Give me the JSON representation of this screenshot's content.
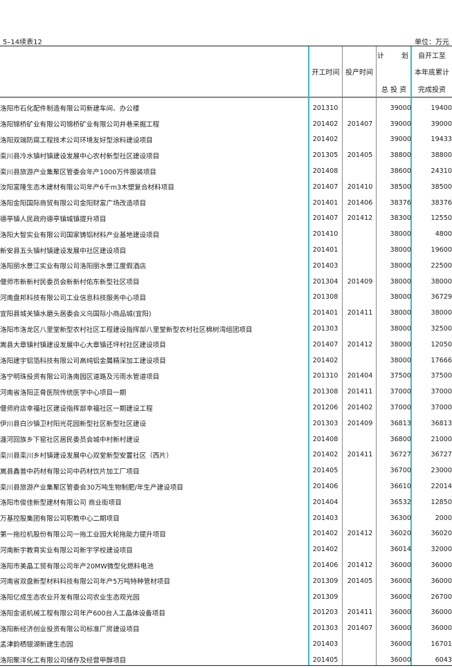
{
  "header": {
    "table_id": "5–14续表12",
    "unit": "单位：万元"
  },
  "columns": {
    "start_time": "开工时间",
    "operation_time": "投产时间",
    "plan_top": [
      "计",
      "划"
    ],
    "plan_bottom": "总 投 资",
    "cumulative": [
      "自开工至",
      "本年底累计",
      "完成投资"
    ]
  },
  "rows": [
    {
      "name": "洛阳市石化配件制造有限公司新建车间、办公楼",
      "start": "201310",
      "op": "",
      "total": "39000",
      "cum": "19400"
    },
    {
      "name": "洛阳锦桥矿业有限公司锦桥矿业有限公司井巷采掘工程",
      "start": "201402",
      "op": "201407",
      "total": "39000",
      "cum": "39000"
    },
    {
      "name": "洛阳双瑞防腐工程技术公司环境友好型涂料建设项目",
      "start": "201402",
      "op": "",
      "total": "39000",
      "cum": "19433"
    },
    {
      "name": "栾川县冷水镇村镇建设发展中心农村新型社区建设项目",
      "start": "201305",
      "op": "201405",
      "total": "38800",
      "cum": "38800"
    },
    {
      "name": "栾川县旅游产业集聚区管委会年产1000万件服装项目",
      "start": "201408",
      "op": "",
      "total": "38600",
      "cum": "24310"
    },
    {
      "name": "汝阳富隆生态木建材有限公司年产6千m3木塑复合材料项目",
      "start": "201407",
      "op": "201410",
      "total": "38500",
      "cum": "38500"
    },
    {
      "name": "洛阳金阳国际商贸有限公司金阳财富广场改造项目",
      "start": "201401",
      "op": "201406",
      "total": "38376",
      "cum": "38376"
    },
    {
      "name": "德亭镇人民政府德亭镇城镇提升项目",
      "start": "201407",
      "op": "201412",
      "total": "38300",
      "cum": "12550"
    },
    {
      "name": "洛阳大智实业有限公司国家铸铝材料产业基地建设项目",
      "start": "201410",
      "op": "",
      "total": "38000",
      "cum": "4800"
    },
    {
      "name": "新安县五头镇村镇建设发展中社区建设项目",
      "start": "201401",
      "op": "",
      "total": "38000",
      "cum": "19600"
    },
    {
      "name": "洛阳丽水景江实业有限公司洛阳丽水景江度假酒店",
      "start": "201403",
      "op": "",
      "total": "38000",
      "cum": "22500"
    },
    {
      "name": "偃师市新新村民委员会新新村佑东新型社区项目",
      "start": "201304",
      "op": "201409",
      "total": "38000",
      "cum": "38000"
    },
    {
      "name": "河南盘邦科技有限公司工业信息科技服务中心项目",
      "start": "201308",
      "op": "",
      "total": "38000",
      "cum": "36729"
    },
    {
      "name": "宜阳县城关镇水磨头居委会义乌国际小商品城(宜阳)",
      "start": "201401",
      "op": "201411",
      "total": "38000",
      "cum": "38000"
    },
    {
      "name": "洛阳市洛龙区八里堂新型农村社区工程建设指挥部八里堂新型农村社区棉树湾组团项目",
      "start": "201303",
      "op": "",
      "total": "38000",
      "cum": "32500"
    },
    {
      "name": "嵩县大章镇村镇建设发展中心大章镇还坪村社区建设项目",
      "start": "201407",
      "op": "201412",
      "total": "38000",
      "cum": "12050"
    },
    {
      "name": "洛阳建宇铝箔科技有限公司高纯铝金属精深加工建设项目",
      "start": "201402",
      "op": "",
      "total": "38000",
      "cum": "17666"
    },
    {
      "name": "洛宁明珠投资有限公司洛南园区道路及污雨水管道项目",
      "start": "201310",
      "op": "201404",
      "total": "37500",
      "cum": "37500"
    },
    {
      "name": "河南省洛阳正骨医院传统医学中心项目一期",
      "start": "201308",
      "op": "201411",
      "total": "37000",
      "cum": "37000"
    },
    {
      "name": "偃师府店幸福社区建设指挥部幸福社区一期建设工程",
      "start": "201206",
      "op": "201402",
      "total": "37000",
      "cum": "37000"
    },
    {
      "name": "伊川县白沙镇卫村阳光花园新型社区新型社区建设",
      "start": "201303",
      "op": "201409",
      "total": "36813",
      "cum": "36813"
    },
    {
      "name": "瀍河回族乡下窑社区居民委员会城中村新村建设",
      "start": "201408",
      "op": "",
      "total": "36800",
      "cum": "21000"
    },
    {
      "name": "栾川县栾川乡村镇建设发展中心双堂新型安置社区（西片）",
      "start": "201402",
      "op": "201411",
      "total": "36727",
      "cum": "36727"
    },
    {
      "name": "嵩县鑫普中药材有限公司中药材饮片加工厂项目",
      "start": "201405",
      "op": "",
      "total": "36700",
      "cum": "23000"
    },
    {
      "name": "栾川县旅游产业集聚区管委会30万吨生物制肥/年生产建设项目",
      "start": "201406",
      "op": "",
      "total": "36610",
      "cum": "22014"
    },
    {
      "name": "洛阳市俊佳新型建材有限公司 商业街项目",
      "start": "201404",
      "op": "",
      "total": "36532",
      "cum": "12850"
    },
    {
      "name": "万基控股集团有限公司职教中心二期项目",
      "start": "201403",
      "op": "",
      "total": "36300",
      "cum": "2000"
    },
    {
      "name": "第一拖拉机股份有限公司一拖工业园大轮拖能力提升项目",
      "start": "201402",
      "op": "201412",
      "total": "36020",
      "cum": "36020"
    },
    {
      "name": "河南新宇教育实业有限公司新宇学校建设项目",
      "start": "201402",
      "op": "",
      "total": "36014",
      "cum": "32000"
    },
    {
      "name": "洛阳市美晶工贸有限公司年产20MW微型化燃料电池",
      "start": "201406",
      "op": "201412",
      "total": "36000",
      "cum": "36000"
    },
    {
      "name": "河南省双盘新型材料科技有限公司年产5万吨特种管材项目",
      "start": "201309",
      "op": "201405",
      "total": "36000",
      "cum": "36000"
    },
    {
      "name": "洛阳亿成生态农业开发有限公司农业生态观光园",
      "start": "201309",
      "op": "",
      "total": "36000",
      "cum": "26700"
    },
    {
      "name": "洛阳金诺机械工程有限公司年产600台人工晶体设备项目",
      "start": "201203",
      "op": "201411",
      "total": "36000",
      "cum": "36000"
    },
    {
      "name": "洛阳新经济创业投资有限公司标准厂房建设项目",
      "start": "201303",
      "op": "201407",
      "total": "36000",
      "cum": "36000"
    },
    {
      "name": "孟津韵栖银湖新建生态园",
      "start": "201403",
      "op": "",
      "total": "36000",
      "cum": "16701"
    },
    {
      "name": "洛阳聚洋化工有限公司储存及经营甲醇项目",
      "start": "201405",
      "op": "",
      "total": "36000",
      "cum": "6043"
    }
  ]
}
